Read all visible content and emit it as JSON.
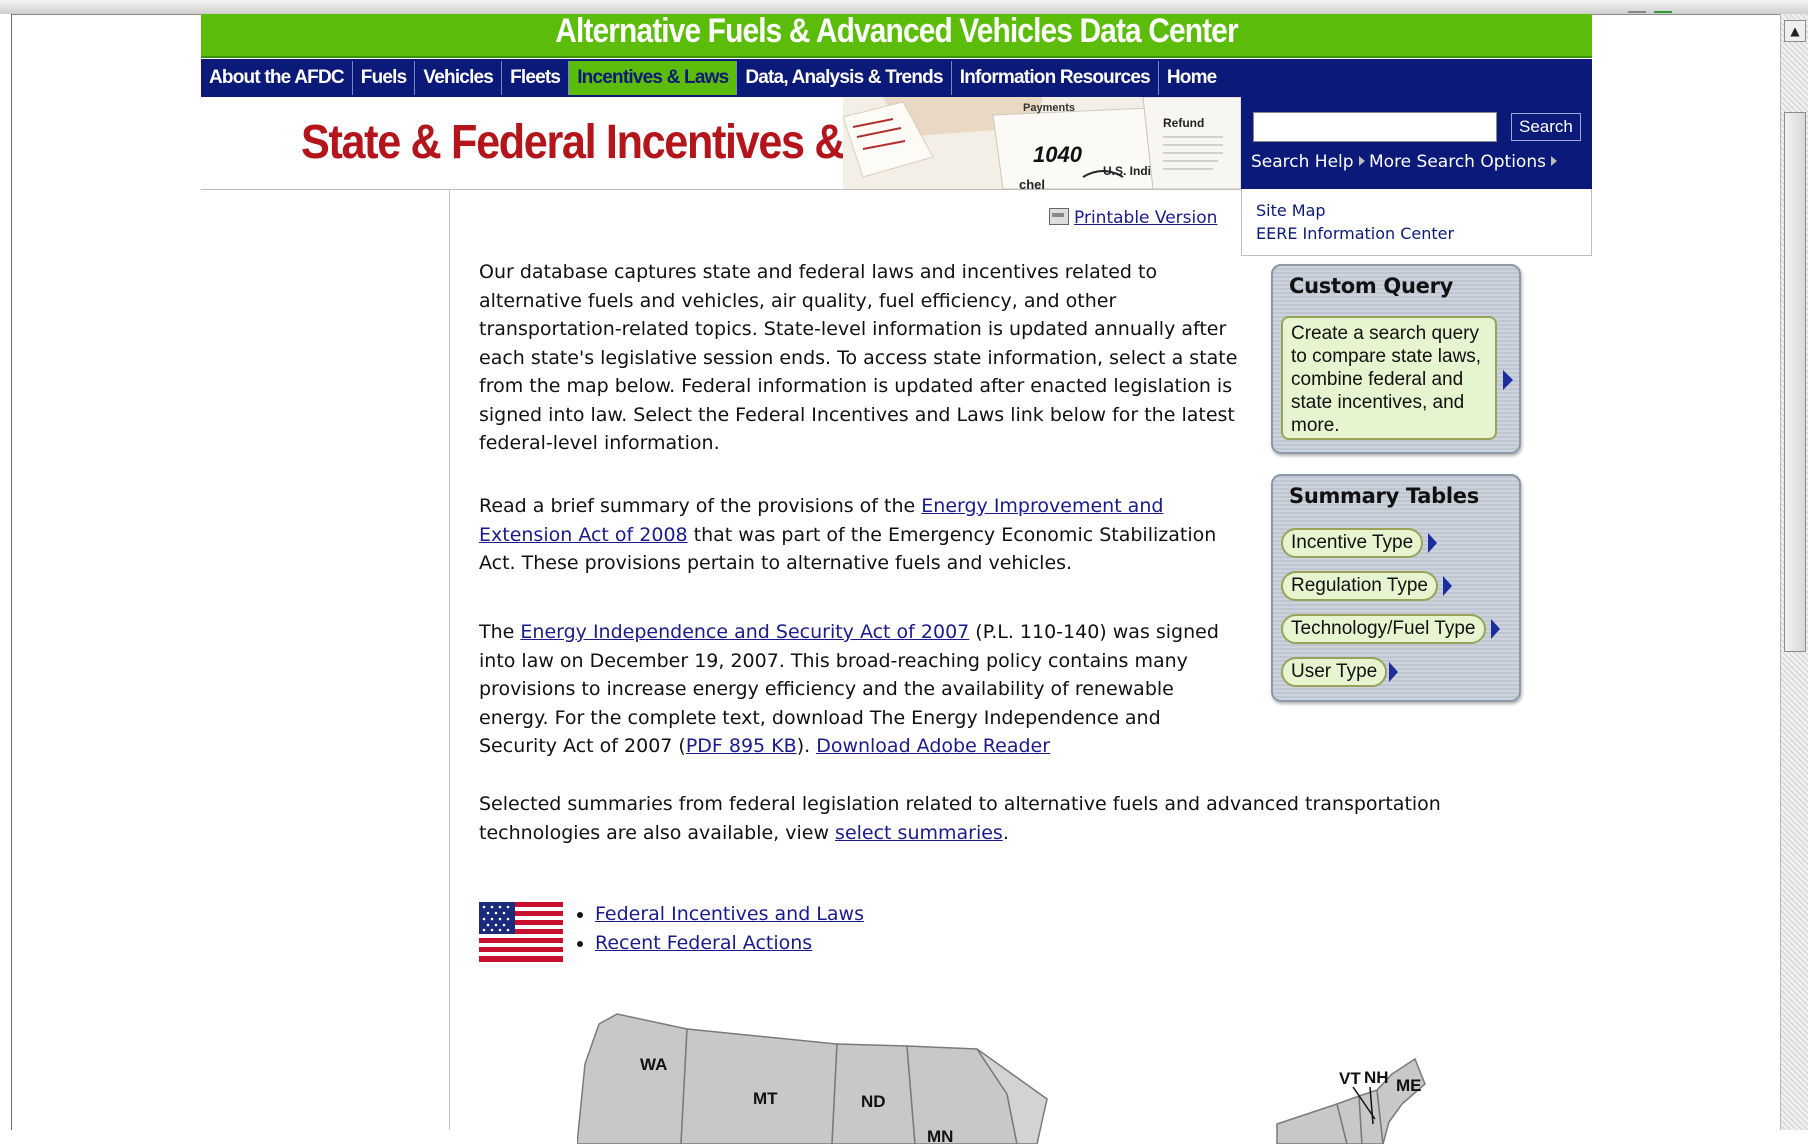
{
  "site": {
    "banner_title": "Alternative Fuels & Advanced Vehicles Data Center"
  },
  "nav": {
    "items": [
      {
        "label": "About the AFDC"
      },
      {
        "label": "Fuels"
      },
      {
        "label": "Vehicles"
      },
      {
        "label": "Fleets"
      },
      {
        "label": "Incentives & Laws"
      },
      {
        "label": "Data, Analysis & Trends"
      },
      {
        "label": "Information Resources"
      },
      {
        "label": "Home"
      }
    ],
    "active": "Incentives & Laws"
  },
  "header": {
    "page_heading": "State & Federal Incentives & Laws",
    "art_text": {
      "payments": "Payments",
      "form": "1040",
      "refund": "Refund",
      "us": "U.S. Indi",
      "chel": "chel"
    }
  },
  "search": {
    "input_value": "",
    "button_label": "Search",
    "help_label": "Search Help",
    "options_label": "More Search Options"
  },
  "site_links": [
    "Site Map",
    "EERE Information Center"
  ],
  "printable_label": "Printable Version",
  "intro": {
    "p1": "Our database captures state and federal laws and incentives related to alternative fuels and vehicles, air quality, fuel efficiency, and other transportation-related topics. State-level information is updated annually after each state's legislative session ends. To access state information, select a state from the map below. Federal information is updated after enacted legislation is signed into law. Select the Federal Incentives and Laws link below for the latest federal-level information.",
    "p2_prefix": "Read a brief summary of the provisions of the ",
    "p2_link": "Energy Improvement and Extension Act of 2008",
    "p2_suffix": " that was part of the Emergency Economic Stabilization Act. These provisions pertain to alternative fuels and vehicles.",
    "p3_prefix": "The ",
    "p3_link": "Energy Independence and Security Act of 2007",
    "p3_mid": " (P.L. 110-140) was signed into law on December 19, 2007. This broad-reaching policy contains many provisions to increase energy efficiency and the availability of renewable energy. For the complete text, download The Energy Independence and Security Act of 2007 (",
    "p3_pdf_link": "PDF 895 KB",
    "p3_after_pdf": "). ",
    "p3_reader_link": "Download Adobe Reader",
    "p4_prefix": "Selected summaries from federal legislation related to alternative fuels and advanced transportation technologies are also available, view ",
    "p4_link": "select summaries",
    "p4_suffix": "."
  },
  "custom_query": {
    "title": "Custom Query",
    "text": "Create a search query to compare state laws, combine federal and state incentives, and more."
  },
  "summary_tables": {
    "title": "Summary Tables",
    "items": [
      "Incentive Type",
      "Regulation Type",
      "Technology/Fuel Type",
      "User Type"
    ]
  },
  "federal_links": [
    "Federal Incentives and Laws",
    "Recent Federal Actions"
  ],
  "map": {
    "states": [
      "WA",
      "MT",
      "ND",
      "MN",
      "VT",
      "NH",
      "ME"
    ]
  },
  "colors": {
    "banner_green": "#5bbd0a",
    "nav_blue": "#0b1a78",
    "heading_red": "#b3151b",
    "link_blue": "#1a1a8c"
  }
}
